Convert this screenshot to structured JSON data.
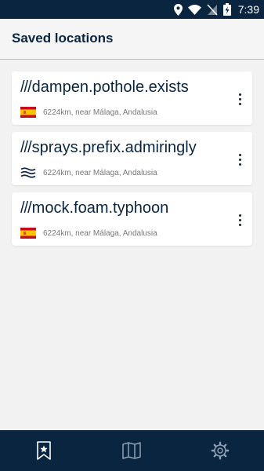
{
  "status_bar": {
    "time": "7:39",
    "icons": [
      "location-icon",
      "wifi-icon",
      "no-sim-icon",
      "battery-charging-icon"
    ]
  },
  "header": {
    "title": "Saved locations"
  },
  "slash_prefix": "///",
  "locations": [
    {
      "words": "dampen.pothole.exists",
      "detail": "6224km, near Málaga, Andalusia",
      "icon": "spain-flag-icon"
    },
    {
      "words": "sprays.prefix.admiringly",
      "detail": "6224km, near Málaga, Andalusia",
      "icon": "water-waves-icon"
    },
    {
      "words": "mock.foam.typhoon",
      "detail": "6224km, near Málaga, Andalusia",
      "icon": "spain-flag-icon"
    }
  ],
  "bottom_nav": {
    "items": [
      "bookmark-star-icon",
      "map-icon",
      "settings-gear-icon"
    ],
    "active": "bookmark-star-icon"
  },
  "colors": {
    "brand_dark": "#0a2540",
    "background": "#f2f2f2",
    "card": "#ffffff",
    "secondary_text": "#777777",
    "flag_red": "#c60b1e",
    "flag_yellow": "#ffc400"
  }
}
